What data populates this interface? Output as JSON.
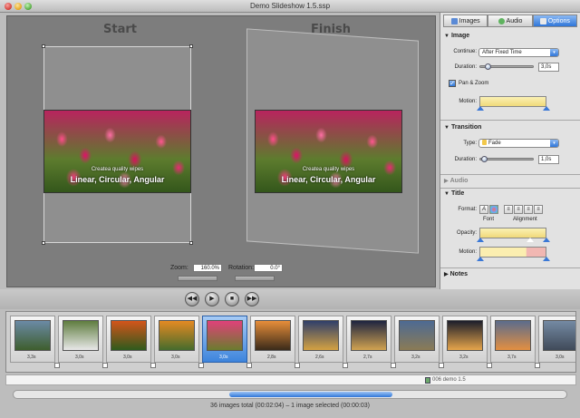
{
  "window": {
    "title": "Demo Slideshow 1.5.ssp"
  },
  "preview": {
    "start_label": "Start",
    "finish_label": "Finish",
    "caption_line1": "Createa quality wipes",
    "caption_line2": "Linear, Circular, Angular",
    "zoom_label": "Zoom:",
    "zoom_value": "160.0%",
    "rotation_label": "Rotation:",
    "rotation_value": "0.0°"
  },
  "tabs": [
    {
      "label": "Images",
      "icon": "images-icon"
    },
    {
      "label": "Audio",
      "icon": "audio-icon"
    },
    {
      "label": "Options",
      "icon": "options-icon",
      "active": true
    }
  ],
  "panel": {
    "image": {
      "header": "Image",
      "continue_label": "Continue:",
      "continue_value": "After Fixed Time",
      "duration_label": "Duration:",
      "duration_value": "3,0s",
      "panzoom_label": "Pan & Zoom",
      "motion_label": "Motion:"
    },
    "transition": {
      "header": "Transition",
      "type_label": "Type:",
      "type_value": "Fade",
      "duration_label": "Duration:",
      "duration_value": "1,0s"
    },
    "audio": {
      "header": "Audio"
    },
    "title": {
      "header": "Title",
      "format_label": "Format:",
      "font_caption": "Font",
      "alignment_caption": "Alignment",
      "opacity_label": "Opacity:",
      "motion_label": "Motion:"
    },
    "notes": {
      "header": "Notes"
    }
  },
  "timeline": {
    "slides": [
      {
        "duration": "3,3s",
        "colors": [
          "#6b8aa6",
          "#3e5e2d"
        ]
      },
      {
        "duration": "3,0s",
        "colors": [
          "#5f7d3f",
          "#e8e8e8"
        ]
      },
      {
        "duration": "3,0s",
        "colors": [
          "#d4551b",
          "#2e5a1c"
        ]
      },
      {
        "duration": "3,0s",
        "colors": [
          "#e58a23",
          "#466c2c"
        ]
      },
      {
        "duration": "3,0s",
        "colors": [
          "#e0417a",
          "#6a7c2e"
        ],
        "selected": true
      },
      {
        "duration": "2,8s",
        "colors": [
          "#e78e3a",
          "#3a2a1a"
        ]
      },
      {
        "duration": "2,6s",
        "colors": [
          "#2f3f6a",
          "#d4a242"
        ]
      },
      {
        "duration": "2,7s",
        "colors": [
          "#1e2440",
          "#d1a350"
        ]
      },
      {
        "duration": "3,2s",
        "colors": [
          "#4d6a93",
          "#8b7b55"
        ]
      },
      {
        "duration": "3,2s",
        "colors": [
          "#1c1e2b",
          "#e6a54a"
        ]
      },
      {
        "duration": "3,7s",
        "colors": [
          "#5b6c8c",
          "#e38f41"
        ]
      },
      {
        "duration": "3,0s",
        "colors": [
          "#748aa3",
          "#404a59"
        ]
      }
    ],
    "audio_label": "006 demo 1.5"
  },
  "status": "36 images total (00:02:04)  –  1 image selected (00:00:03)"
}
